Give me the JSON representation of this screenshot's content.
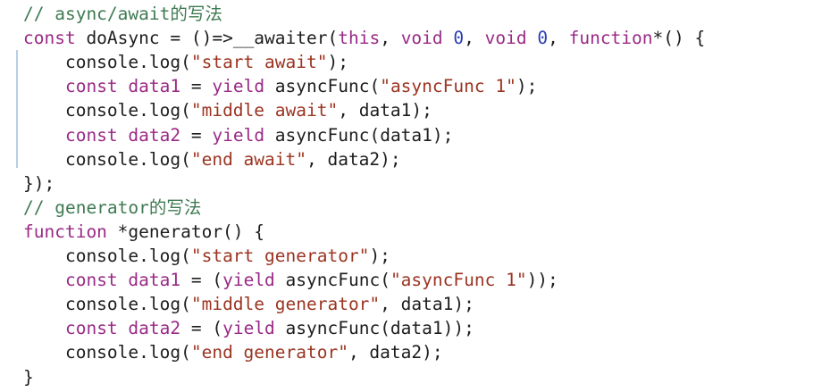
{
  "editor": {
    "language": "javascript",
    "colors": {
      "comment": "#3e7a52",
      "keyword": "#9a2a86",
      "plain": "#1d1d1d",
      "string": "#9b3421",
      "number": "#2a3fb3"
    },
    "lines": [
      [
        {
          "t": "comment",
          "v": "// async/await的写法"
        }
      ],
      [
        {
          "t": "keyword",
          "v": "const"
        },
        {
          "t": "plain",
          "v": " doAsync "
        },
        {
          "t": "cursor",
          "v": "="
        },
        {
          "t": "plain",
          "v": " ()=>__awaiter("
        },
        {
          "t": "keyword",
          "v": "this"
        },
        {
          "t": "plain",
          "v": ", "
        },
        {
          "t": "keyword",
          "v": "void"
        },
        {
          "t": "plain",
          "v": " "
        },
        {
          "t": "number",
          "v": "0"
        },
        {
          "t": "plain",
          "v": ", "
        },
        {
          "t": "keyword",
          "v": "void"
        },
        {
          "t": "plain",
          "v": " "
        },
        {
          "t": "number",
          "v": "0"
        },
        {
          "t": "plain",
          "v": ", "
        },
        {
          "t": "keyword",
          "v": "function"
        },
        {
          "t": "plain",
          "v": "*() {"
        }
      ],
      [
        {
          "t": "plain",
          "v": "    console.log("
        },
        {
          "t": "string",
          "v": "\"start await\""
        },
        {
          "t": "plain",
          "v": ");"
        }
      ],
      [
        {
          "t": "plain",
          "v": "    "
        },
        {
          "t": "keyword",
          "v": "const"
        },
        {
          "t": "plain",
          "v": " "
        },
        {
          "t": "keyword",
          "v": "data1"
        },
        {
          "t": "plain",
          "v": " = "
        },
        {
          "t": "keyword",
          "v": "yield"
        },
        {
          "t": "plain",
          "v": " asyncFunc("
        },
        {
          "t": "string",
          "v": "\"asyncFunc 1\""
        },
        {
          "t": "plain",
          "v": ");"
        }
      ],
      [
        {
          "t": "plain",
          "v": "    console.log("
        },
        {
          "t": "string",
          "v": "\"middle await\""
        },
        {
          "t": "plain",
          "v": ", data1);"
        }
      ],
      [
        {
          "t": "plain",
          "v": "    "
        },
        {
          "t": "keyword",
          "v": "const"
        },
        {
          "t": "plain",
          "v": " "
        },
        {
          "t": "keyword",
          "v": "data2"
        },
        {
          "t": "plain",
          "v": " = "
        },
        {
          "t": "keyword",
          "v": "yield"
        },
        {
          "t": "plain",
          "v": " asyncFunc(data1);"
        }
      ],
      [
        {
          "t": "plain",
          "v": "    console.log("
        },
        {
          "t": "string",
          "v": "\"end await\""
        },
        {
          "t": "plain",
          "v": ", data2);"
        }
      ],
      [
        {
          "t": "plain",
          "v": "});"
        }
      ],
      [
        {
          "t": "comment",
          "v": "// generator的写法"
        }
      ],
      [
        {
          "t": "keyword",
          "v": "function"
        },
        {
          "t": "plain",
          "v": " *generator() {"
        }
      ],
      [
        {
          "t": "plain",
          "v": "    console.log("
        },
        {
          "t": "string",
          "v": "\"start generator\""
        },
        {
          "t": "plain",
          "v": ");"
        }
      ],
      [
        {
          "t": "plain",
          "v": "    "
        },
        {
          "t": "keyword",
          "v": "const"
        },
        {
          "t": "plain",
          "v": " "
        },
        {
          "t": "keyword",
          "v": "data1"
        },
        {
          "t": "plain",
          "v": " = ("
        },
        {
          "t": "keyword",
          "v": "yield"
        },
        {
          "t": "plain",
          "v": " asyncFunc("
        },
        {
          "t": "string",
          "v": "\"asyncFunc 1\""
        },
        {
          "t": "plain",
          "v": "));"
        }
      ],
      [
        {
          "t": "plain",
          "v": "    console.log("
        },
        {
          "t": "string",
          "v": "\"middle generator\""
        },
        {
          "t": "plain",
          "v": ", data1);"
        }
      ],
      [
        {
          "t": "plain",
          "v": "    "
        },
        {
          "t": "keyword",
          "v": "const"
        },
        {
          "t": "plain",
          "v": " "
        },
        {
          "t": "keyword",
          "v": "data2"
        },
        {
          "t": "plain",
          "v": " = ("
        },
        {
          "t": "keyword",
          "v": "yield"
        },
        {
          "t": "plain",
          "v": " asyncFunc(data1));"
        }
      ],
      [
        {
          "t": "plain",
          "v": "    console.log("
        },
        {
          "t": "string",
          "v": "\"end generator\""
        },
        {
          "t": "plain",
          "v": ", data2);"
        }
      ],
      [
        {
          "t": "plain",
          "v": "}"
        }
      ]
    ]
  }
}
